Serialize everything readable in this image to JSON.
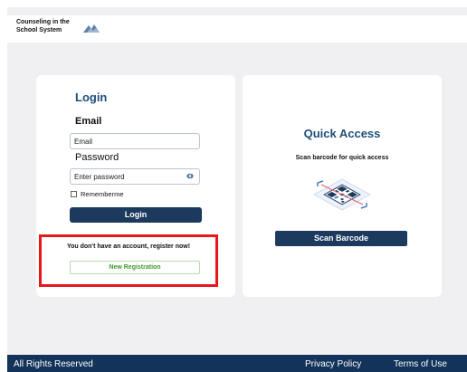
{
  "header": {
    "brand_line1": "Counseling in the",
    "brand_line2": "School System",
    "logo_icon": "mountain-logo-icon"
  },
  "login": {
    "title": "Login",
    "email_label": "Email",
    "email_placeholder": "Email",
    "password_label": "Password",
    "password_placeholder": "Enter password",
    "remember_label": "Rememberme",
    "login_button": "Login",
    "register_prompt": "You don't have an account, register now!",
    "new_registration_button": "New Registration"
  },
  "quick_access": {
    "title": "Quick Access",
    "subtitle": "Scan barcode for quick access",
    "scan_button": "Scan Barcode",
    "illustration_icon": "qr-code-scan-icon"
  },
  "footer": {
    "rights": "All Rights Reserved",
    "privacy": "Privacy Policy",
    "terms": "Terms of Use"
  },
  "colors": {
    "primary_navy": "#1b3a5e",
    "title_blue": "#1f4e7a",
    "highlight_red": "#e8171c",
    "registration_green": "#3f9a2e",
    "page_background": "#f0f0f2"
  }
}
